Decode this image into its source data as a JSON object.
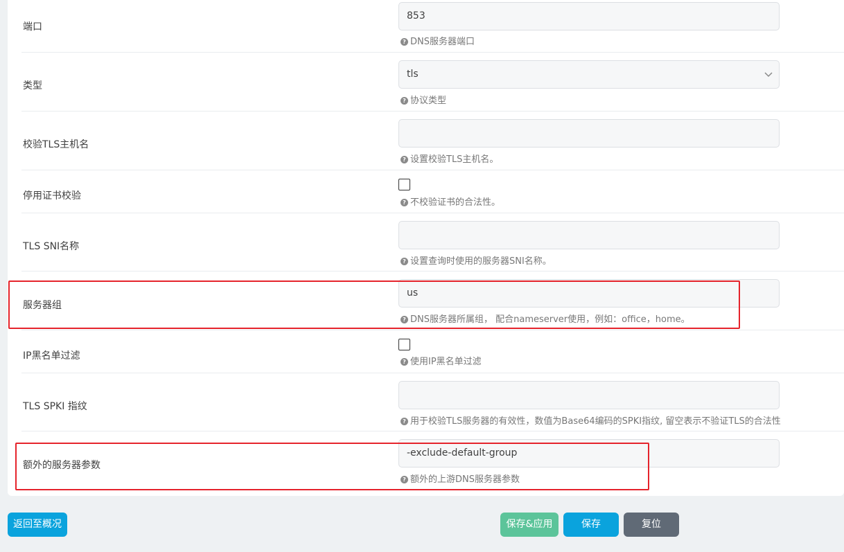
{
  "form": {
    "rows": [
      {
        "label": "端口",
        "value": "853",
        "hint": "DNS服务器端口"
      },
      {
        "label": "类型",
        "value": "tls",
        "hint": "协议类型"
      },
      {
        "label": "校验TLS主机名",
        "value": "",
        "hint": "设置校验TLS主机名。"
      },
      {
        "label": "停用证书校验",
        "checked": false,
        "hint": "不校验证书的合法性。"
      },
      {
        "label": "TLS SNI名称",
        "value": "",
        "hint": "设置查询时使用的服务器SNI名称。"
      },
      {
        "label": "服务器组",
        "value": "us",
        "hint": "DNS服务器所属组， 配合nameserver使用，例如：office，home。"
      },
      {
        "label": "IP黑名单过滤",
        "checked": false,
        "hint": "使用IP黑名单过滤"
      },
      {
        "label": "TLS SPKI 指纹",
        "value": "",
        "hint": "用于校验TLS服务器的有效性，数值为Base64编码的SPKI指纹, 留空表示不验证TLS的合法性"
      },
      {
        "label": "额外的服务器参数",
        "value": "-exclude-default-group",
        "hint": "额外的上游DNS服务器参数"
      }
    ],
    "hint_icon": "question-circle-icon",
    "select_icon": "chevron-down-icon"
  },
  "actions": {
    "back_label": "返回至概况",
    "save_apply_label": "保存&应用",
    "save_label": "保存",
    "reset_label": "复位"
  },
  "colors": {
    "highlight": "#e5232b",
    "primary": "#0aa3dd",
    "success": "#5cc49a",
    "neutral": "#606a76"
  }
}
